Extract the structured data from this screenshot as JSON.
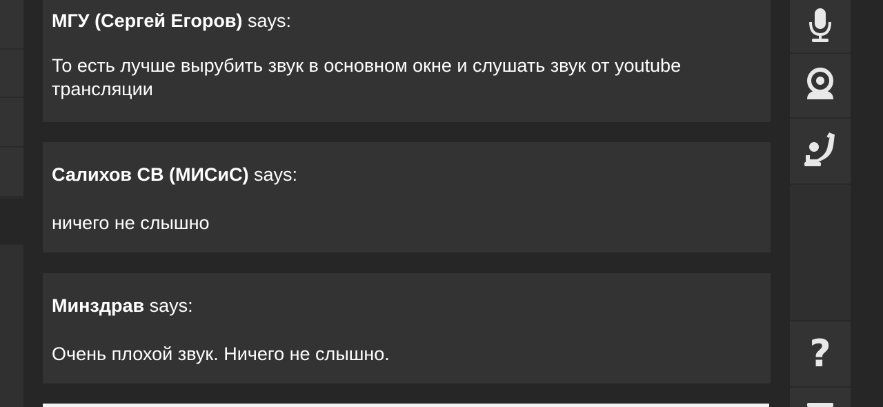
{
  "messages": [
    {
      "author": "МГУ (Сергей Егоров)",
      "says": "says:",
      "text": "То есть лучше вырубить звук в основном окне и слушать звук от youtube трансляции"
    },
    {
      "author": "Салихов СВ (МИСиС)",
      "says": "says:",
      "text": "ничего не слышно"
    },
    {
      "author": "Минздрав",
      "says": "says:",
      "text": "Очень плохой звук. Ничего не слышно."
    }
  ],
  "toolbar": {
    "icons": [
      "microphone-icon",
      "webcam-icon",
      "raise-hand-icon",
      "help-icon",
      "menu-icon"
    ],
    "help_glyph": "?"
  },
  "colors": {
    "background": "#262626",
    "message_bg": "#333333",
    "text": "#ffffff",
    "icon": "#e8e8e8",
    "input_bar": "#f2f2f2"
  }
}
